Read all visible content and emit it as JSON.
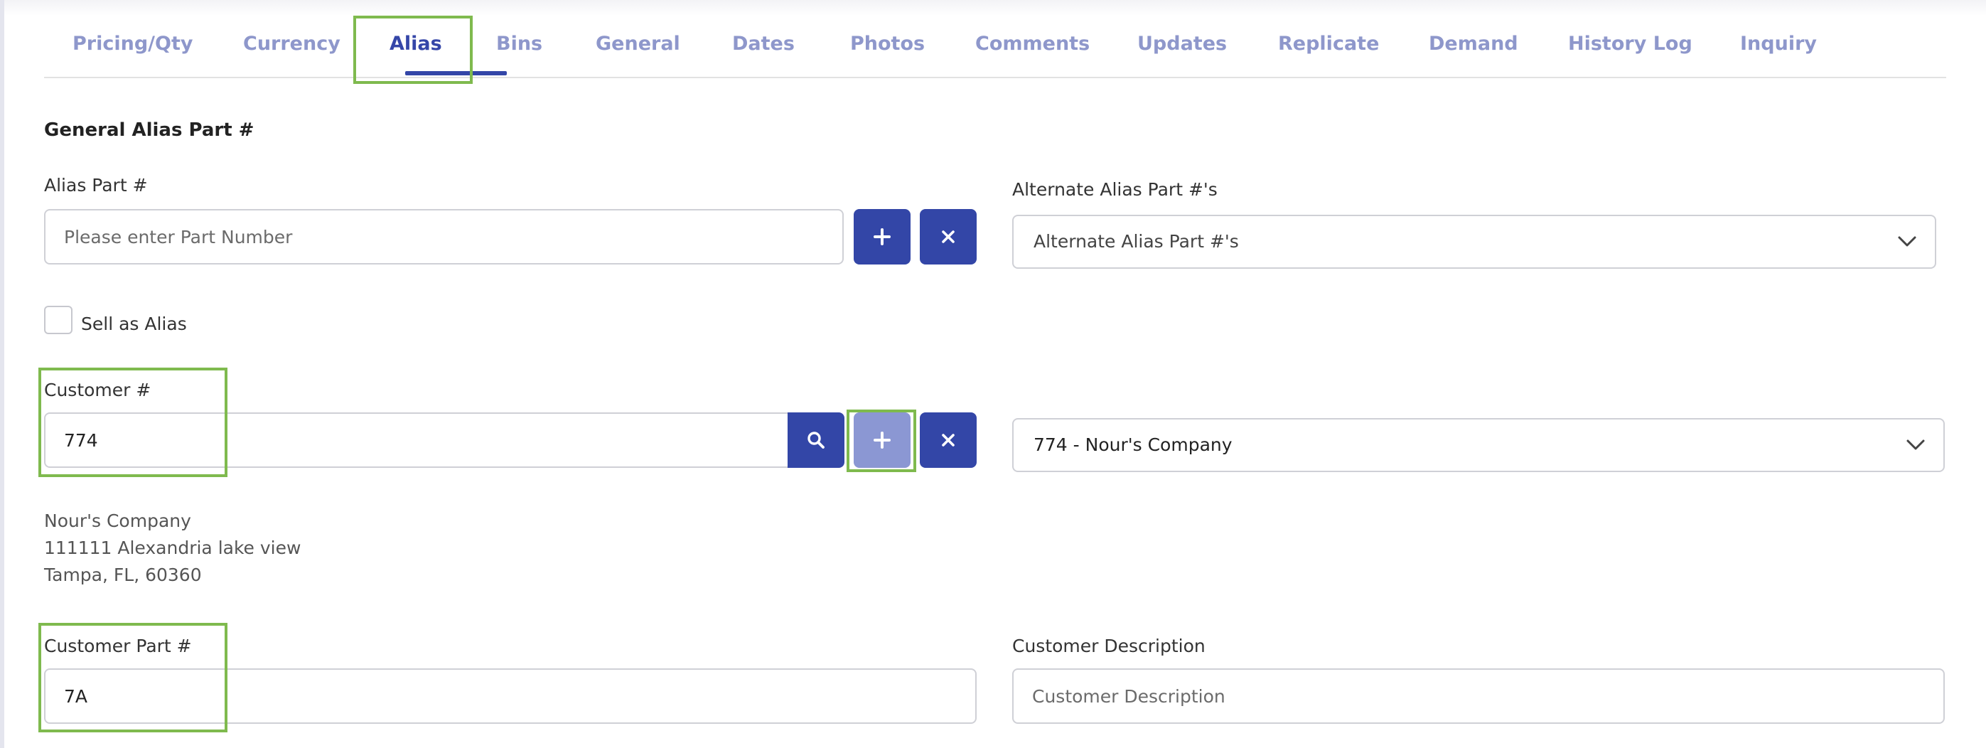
{
  "tabs": [
    {
      "label": "Pricing/Qty"
    },
    {
      "label": "Currency"
    },
    {
      "label": "Alias"
    },
    {
      "label": "Bins"
    },
    {
      "label": "General"
    },
    {
      "label": "Dates"
    },
    {
      "label": "Photos"
    },
    {
      "label": "Comments"
    },
    {
      "label": "Updates"
    },
    {
      "label": "Replicate"
    },
    {
      "label": "Demand"
    },
    {
      "label": "History Log"
    },
    {
      "label": "Inquiry"
    }
  ],
  "active_tab": "Alias",
  "section": {
    "title": "General Alias Part #"
  },
  "alias_part": {
    "label": "Alias Part #",
    "placeholder": "Please enter Part Number",
    "value": ""
  },
  "alternate_alias": {
    "label": "Alternate Alias Part #'s",
    "selected": "Alternate Alias Part #'s"
  },
  "sell_as_alias": {
    "label": "Sell as Alias",
    "checked": false
  },
  "customer_number": {
    "label": "Customer #",
    "value": "774"
  },
  "customer_select": {
    "selected": "774 - Nour's Company"
  },
  "customer_info": {
    "name": "Nour's Company",
    "address": "111111 Alexandria lake view",
    "city_line": "Tampa, FL, 60360"
  },
  "customer_part": {
    "label": "Customer Part #",
    "value": "7A"
  },
  "customer_description": {
    "label": "Customer Description",
    "placeholder": "Customer Description",
    "value": ""
  },
  "icons": {
    "add": "plus-icon",
    "clear": "close-icon",
    "search": "search-icon",
    "dropdown": "chevron-down-icon"
  },
  "colors": {
    "primary": "#3346a7",
    "primary_light": "#8b97d3",
    "tab_inactive": "#8e97cb",
    "highlight": "#7fba4e"
  }
}
